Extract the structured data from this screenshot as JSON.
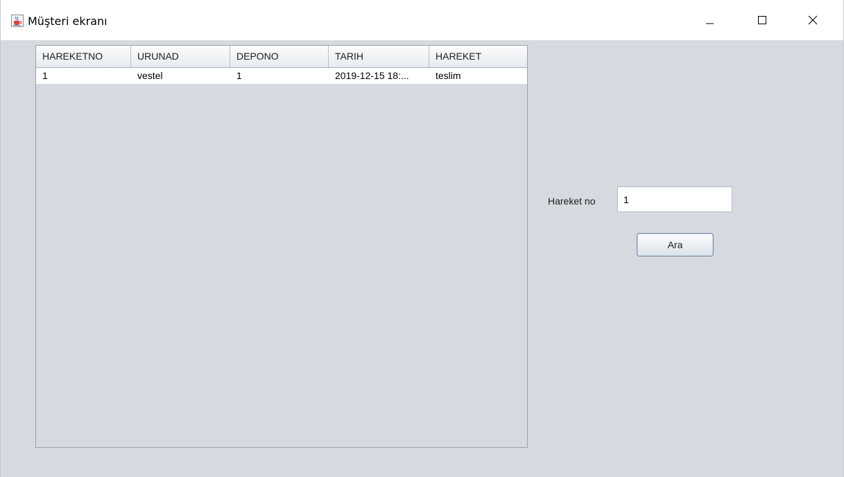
{
  "window": {
    "title": "Müşteri ekranı",
    "icons": {
      "app": "java-cup-icon",
      "minimize": "minimize-icon",
      "maximize": "maximize-icon",
      "close": "close-icon"
    }
  },
  "table": {
    "columns": [
      "HAREKETNO",
      "URUNAD",
      "DEPONO",
      "TARIH",
      "HAREKET"
    ],
    "rows": [
      [
        "1",
        "vestel",
        "1",
        "2019-12-15 18:...",
        "teslim"
      ]
    ]
  },
  "search": {
    "label": "Hareket no",
    "value": "1",
    "button_label": "Ara"
  },
  "colors": {
    "background": "#d6d9e0",
    "titlebar": "#ffffff",
    "row_background": "#ffffff"
  }
}
